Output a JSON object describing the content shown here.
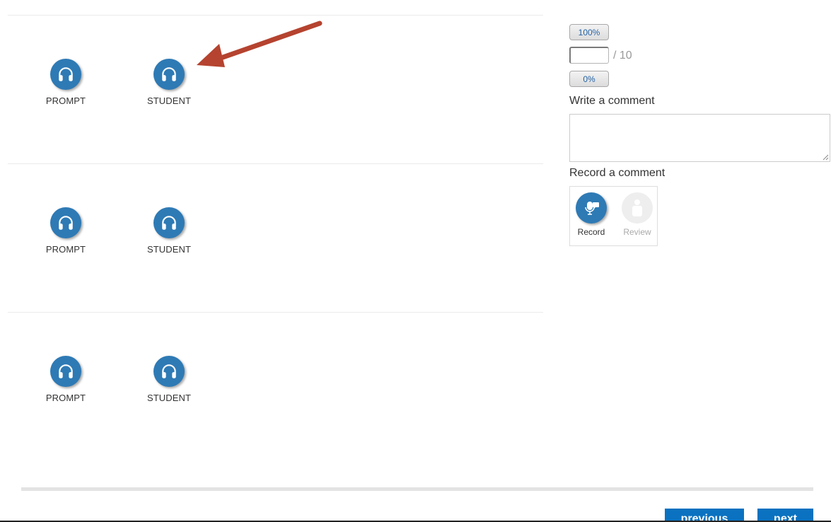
{
  "rows": [
    {
      "prompt_label": "PROMPT",
      "student_label": "STUDENT"
    },
    {
      "prompt_label": "PROMPT",
      "student_label": "STUDENT"
    },
    {
      "prompt_label": "PROMPT",
      "student_label": "STUDENT"
    }
  ],
  "icons": {
    "audio": "headphones-icon",
    "record": "microphone-icon",
    "review": "person-icon",
    "annotation": "arrow-icon"
  },
  "grading": {
    "full_label": "100%",
    "score_value": "",
    "score_total": "/ 10",
    "zero_label": "0%"
  },
  "comments": {
    "write_label": "Write a comment",
    "write_value": "",
    "record_label": "Record a comment",
    "record_button": "Record",
    "review_button": "Review"
  },
  "navigation": {
    "previous_label": "previous",
    "next_label": "next"
  },
  "colors": {
    "accent": "#2e7ab5",
    "nav_button": "#0a72c0",
    "annotation": "#b5432f",
    "percent_text": "#2563a6"
  }
}
